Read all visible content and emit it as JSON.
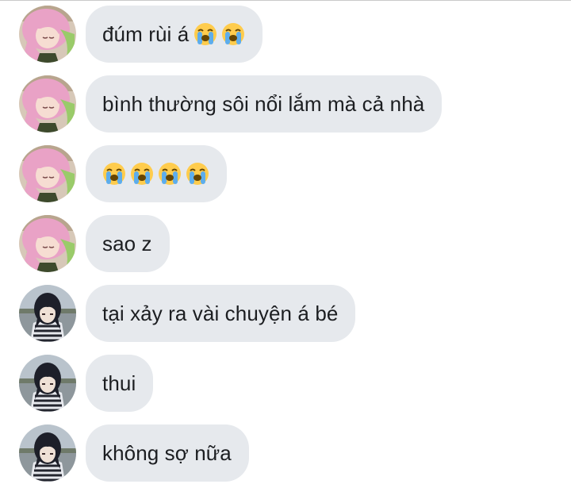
{
  "messages": [
    {
      "sender": "pink-hair",
      "text": "đúm rùi á",
      "emojis": [
        "loudly-crying-face-icon",
        "loudly-crying-face-icon"
      ]
    },
    {
      "sender": "pink-hair",
      "text": "bình thường sôi nổi lắm mà cả nhà",
      "emojis": []
    },
    {
      "sender": "pink-hair",
      "text": "",
      "emojis": [
        "loudly-crying-face-icon",
        "loudly-crying-face-icon",
        "loudly-crying-face-icon",
        "loudly-crying-face-icon"
      ]
    },
    {
      "sender": "pink-hair",
      "text": "sao z",
      "emojis": []
    },
    {
      "sender": "dark-hair",
      "text": "tại xảy ra vài chuyện á bé",
      "emojis": []
    },
    {
      "sender": "dark-hair",
      "text": "thui",
      "emojis": []
    },
    {
      "sender": "dark-hair",
      "text": "không sợ nữa",
      "emojis": []
    }
  ],
  "colors": {
    "bubble": "#e6e9ed",
    "text": "#1c1e21",
    "pink_hair": "#e9a2c6",
    "green_hair": "#9acb6a",
    "dark_hair": "#1d1f29",
    "stripes": "#e7e9ee"
  }
}
